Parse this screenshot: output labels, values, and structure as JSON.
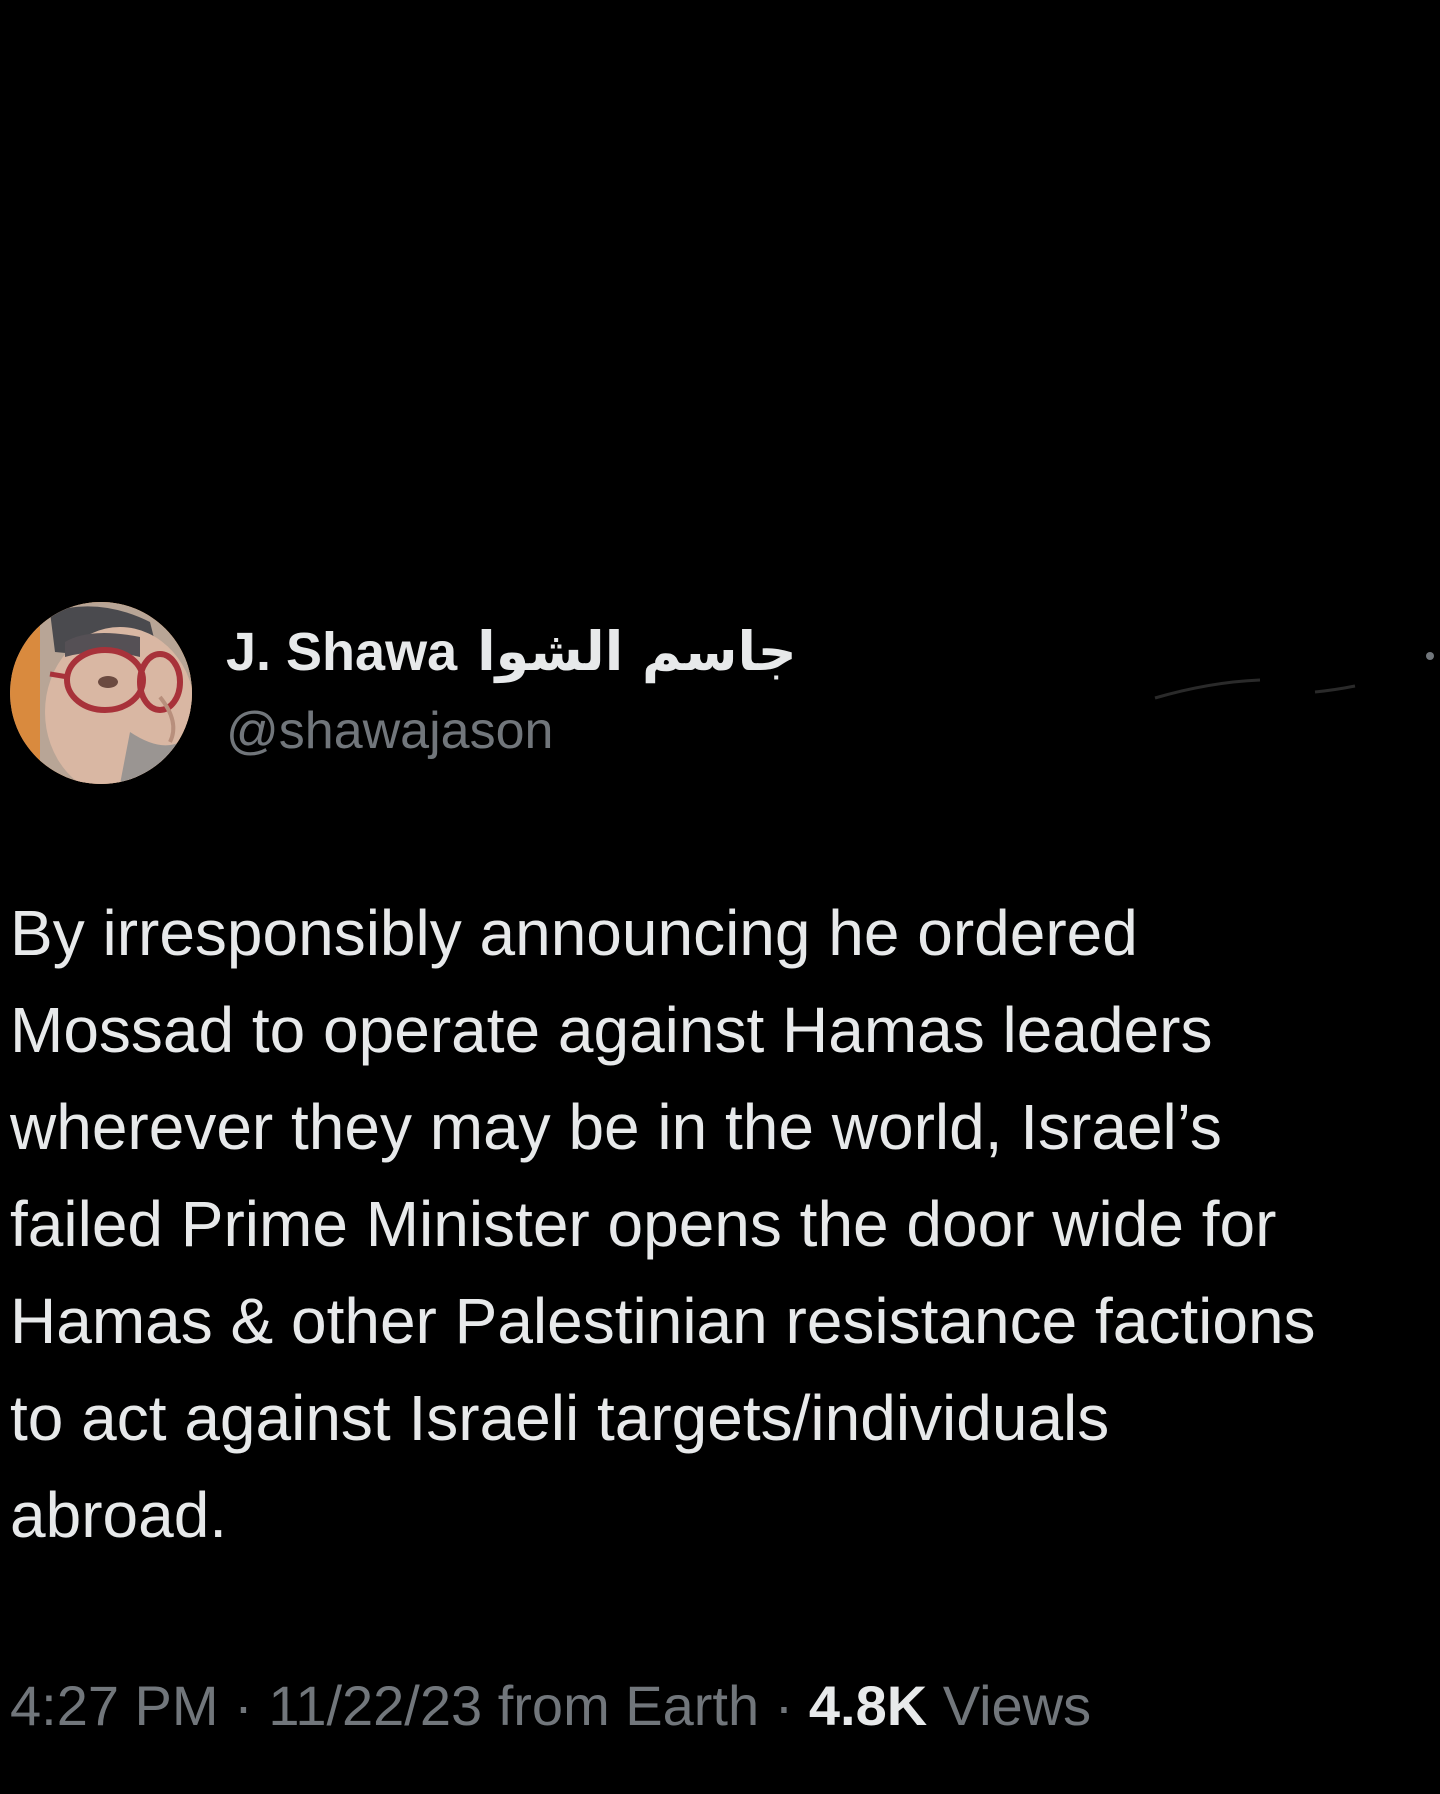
{
  "user": {
    "display_name": "J. Shawa",
    "display_name_arabic": "جاسم الشوا",
    "handle": "@shawajason"
  },
  "tweet": {
    "text": "By irresponsibly announcing he ordered\nMossad to operate against Hamas leaders\nwherever they may be in the world, Israel’s\nfailed Prime Minister opens the door wide for\nHamas & other Palestinian resistance factions\nto act against Israeli targets/individuals\nabroad."
  },
  "meta": {
    "time": "4:27 PM",
    "separator1": " · ",
    "date": "11/22/23",
    "source": " from Earth",
    "separator2": " · ",
    "views_count": "4.8K",
    "views_label": " Views"
  },
  "icons": {
    "more": "more-options-icon"
  },
  "colors": {
    "background": "#000000",
    "primary_text": "#e7e9ea",
    "secondary_text": "#71767b"
  }
}
